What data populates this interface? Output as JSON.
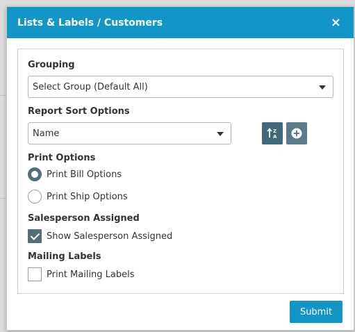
{
  "modal": {
    "title": "Lists & Labels / Customers",
    "close_icon": "×",
    "submit_label": "Submit"
  },
  "grouping": {
    "label": "Grouping",
    "selected": "Select Group (Default All)"
  },
  "sort": {
    "label": "Report Sort Options",
    "selected": "Name",
    "sort_icon": "sort-alpha-icon",
    "add_icon": "plus-circle-icon"
  },
  "print_options": {
    "label": "Print Options",
    "options": [
      {
        "label": "Print Bill Options",
        "checked": true
      },
      {
        "label": "Print Ship Options",
        "checked": false
      }
    ]
  },
  "salesperson": {
    "label": "Salesperson Assigned",
    "checkbox_label": "Show Salesperson Assigned",
    "checked": true
  },
  "mailing": {
    "label": "Mailing Labels",
    "checkbox_label": "Print Mailing Labels",
    "checked": false
  },
  "colors": {
    "header": "#1296c8",
    "control_dark": "#546e7a",
    "sort_button": "#3f6a7d",
    "add_button": "#5a7a8c"
  }
}
